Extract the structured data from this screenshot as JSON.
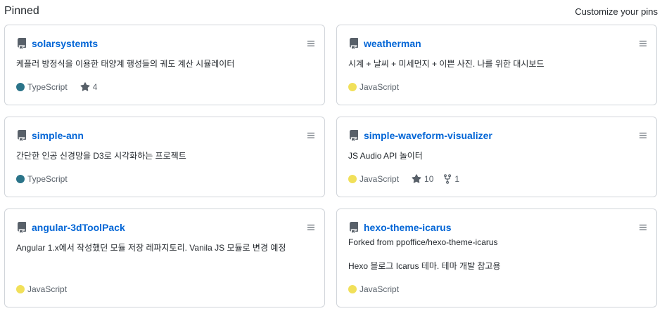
{
  "header": {
    "title": "Pinned",
    "customize_label": "Customize your pins"
  },
  "colors": {
    "link": "#0366d6",
    "typescript": "#2b7489",
    "javascript": "#f1e05a",
    "border": "#d1d5da"
  },
  "cards": [
    {
      "name": "solarsystemts",
      "description": "케플러 방정식을 이용한 태양계 행성들의 궤도 계산 시뮬레이터",
      "language": "TypeScript",
      "stars": "4"
    },
    {
      "name": "weatherman",
      "description": "시계 + 날씨 + 미세먼지 + 이쁜 사진. 나를 위한 대시보드",
      "language": "JavaScript"
    },
    {
      "name": "simple-ann",
      "description": "간단한 인공 신경망을 D3로 시각화하는 프로젝트",
      "language": "TypeScript"
    },
    {
      "name": "simple-waveform-visualizer",
      "description": "JS Audio API 놀이터",
      "language": "JavaScript",
      "stars": "10",
      "forks": "1"
    },
    {
      "name": "angular-3dToolPack",
      "description": "Angular 1.x에서 작성했던 모듈 저장 레파지토리. Vanila JS 모듈로 변경 예정",
      "language": "JavaScript"
    },
    {
      "name": "hexo-theme-icarus",
      "forked_from": "Forked from ppoffice/hexo-theme-icarus",
      "description": "Hexo 블로그 Icarus 테마. 테마 개발 참고용",
      "language": "JavaScript"
    }
  ]
}
